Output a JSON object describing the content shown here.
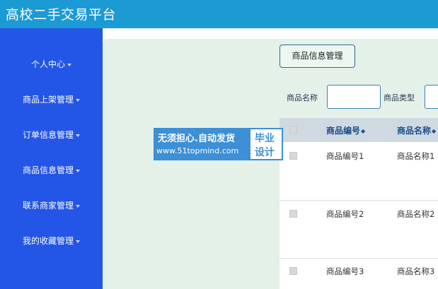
{
  "app": {
    "title": "高校二手交易平台"
  },
  "sidebar": {
    "items": [
      {
        "label": "个人中心"
      },
      {
        "label": "商品上架管理"
      },
      {
        "label": "订单信息管理"
      },
      {
        "label": "商品信息管理"
      },
      {
        "label": "联系商家管理"
      },
      {
        "label": "我的收藏管理"
      }
    ]
  },
  "main": {
    "tab_label": "商品信息管理",
    "search": [
      {
        "label": "商品名称",
        "value": ""
      },
      {
        "label": "商品类型",
        "value": ""
      }
    ],
    "table": {
      "headers": [
        "商品编号",
        "商品名称"
      ],
      "sort_icon": "◆",
      "rows": [
        {
          "code": "商品编号1",
          "name": "商品名称1"
        },
        {
          "code": "商品编号2",
          "name": "商品名称2"
        },
        {
          "code": "商品编号3",
          "name": "商品名称3"
        }
      ]
    }
  },
  "watermark": {
    "line1": "无须担心.自动发货",
    "line2": "www.51topmind.com",
    "badge_top": "毕业",
    "badge_bottom": "设计"
  }
}
